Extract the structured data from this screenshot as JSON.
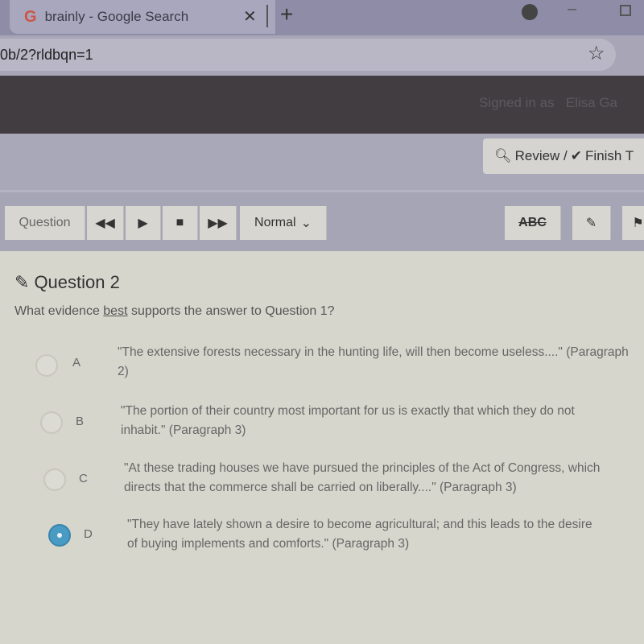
{
  "browser": {
    "tab_title": "brainly - Google Search",
    "tab_favicon": "G",
    "url": "0b/2?rldbqn=1"
  },
  "header": {
    "signed_in": "Signed in as",
    "user": "Elisa Ga",
    "review_label": "Review /",
    "finish_label": "Finish T"
  },
  "toolbar": {
    "question_label": "Question",
    "speed": "Normal",
    "abc_label": "ABC"
  },
  "question": {
    "title": "Question 2",
    "prompt_pre": "What evidence ",
    "prompt_emph": "best",
    "prompt_post": " supports the answer to Question 1?",
    "options": [
      {
        "letter": "A",
        "text": "\"The extensive forests necessary in the hunting life, will then become useless....\" (Paragraph 2)",
        "selected": false
      },
      {
        "letter": "B",
        "text": "\"The portion of their country most important for us is exactly that which they do not inhabit.\" (Paragraph 3)",
        "selected": false
      },
      {
        "letter": "C",
        "text": "\"At these trading houses we have pursued the principles of the Act of Congress, which directs that the commerce shall be carried on liberally....\" (Paragraph 3)",
        "selected": false
      },
      {
        "letter": "D",
        "text": "\"They have lately shown a desire to become agricultural; and this leads to the desire of buying implements and comforts.\" (Paragraph 3)",
        "selected": true
      }
    ]
  },
  "colors": {
    "selected": "#4a9bc3",
    "dark_bar": "#423d40"
  }
}
